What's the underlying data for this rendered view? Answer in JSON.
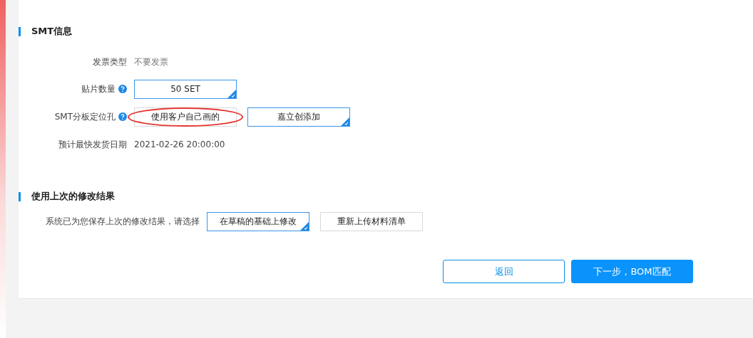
{
  "smt_section": {
    "title": "SMT信息",
    "rows": [
      {
        "label": "发票类型",
        "help": false,
        "kind": "text",
        "value": "不要发票"
      },
      {
        "label": "贴片数量",
        "help": true,
        "kind": "options",
        "options": [
          {
            "label": "50 SET",
            "selected": true,
            "circled": false
          }
        ]
      },
      {
        "label": "SMT分板定位孔",
        "help": true,
        "kind": "options",
        "options": [
          {
            "label": "使用客户自己画的",
            "selected": false,
            "circled": true
          },
          {
            "label": "嘉立创添加",
            "selected": true,
            "circled": false
          }
        ]
      },
      {
        "label": "预计最快发货日期",
        "help": false,
        "kind": "date",
        "value": "2021-02-26 20:00:00"
      }
    ]
  },
  "previous_section": {
    "title": "使用上次的修改结果",
    "prompt": "系统已为您保存上次的修改结果，请选择",
    "options": [
      {
        "label": "在草稿的基础上修改",
        "selected": true
      },
      {
        "label": "重新上传材料清单",
        "selected": false
      }
    ]
  },
  "buttons": [
    {
      "label": "返回",
      "kind": "secondary"
    },
    {
      "label": "下一步，BOM匹配",
      "kind": "primary"
    }
  ]
}
